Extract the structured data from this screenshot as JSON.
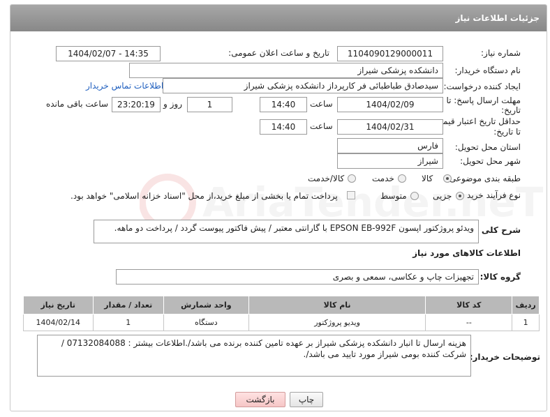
{
  "header": {
    "title": "جزئیات اطلاعات نیاز"
  },
  "form": {
    "need_number_label": "شماره نیاز:",
    "need_number": "1104090129000011",
    "announce_label": "تاریخ و ساعت اعلان عمومی:",
    "announce_value": "1404/02/07 - 14:35",
    "buyer_org_label": "نام دستگاه خریدار:",
    "buyer_org": "دانشکده پزشکی شیراز",
    "requester_label": "ایجاد کننده درخواست:",
    "requester": "سیدصادق طباطبائی فر کارپرداز دانشکده پزشکی شیراز",
    "contact_link": "اطلاعات تماس خریدار",
    "deadline_label_1": "مهلت ارسال پاسخ: تا",
    "deadline_label_2": "تاریخ:",
    "deadline_date": "1404/02/09",
    "time_label": "ساعت",
    "deadline_time": "14:40",
    "days_value": "1",
    "days_label": "روز و",
    "remaining_time": "23:20:19",
    "remaining_label": "ساعت باقی مانده",
    "min_validity_label_1": "حداقل تاریخ اعتبار قیمت:",
    "min_validity_label_2": "تا تاریخ:",
    "validity_date": "1404/02/31",
    "validity_time_label": "ساعت",
    "validity_time": "14:40",
    "province_label": "استان محل تحویل:",
    "province": "فارس",
    "city_label": "شهر محل تحویل:",
    "city": "شیراز",
    "category_label": "طبقه بندی موضوعی:",
    "category_options": [
      "کالا",
      "خدمت",
      "کالا/خدمت"
    ],
    "category_selected": "کالا",
    "process_label": "نوع فرآیند خرید :",
    "process_options": [
      "جزیی",
      "متوسط"
    ],
    "process_selected": "جزیی",
    "payment_note": "پرداخت تمام یا بخشی از مبلغ خرید،از محل \"اسناد خزانه اسلامی\" خواهد بود."
  },
  "description": {
    "label": "شرح کلی نیاز:",
    "text": "ویدئو پروژکتور اپسون EPSON EB-992F با گارانتی معتبر / پیش فاکتور پیوست گردد / پرداخت دو ماهه."
  },
  "goods": {
    "section_title": "اطلاعات کالاهای مورد نیاز",
    "group_label": "گروه کالا:",
    "group_value": "تجهیزات چاپ و عکاسی، سمعی و بصری",
    "columns": [
      "ردیف",
      "کد کالا",
      "نام کالا",
      "واحد شمارش",
      "تعداد / مقدار",
      "تاریخ نیاز"
    ],
    "rows": [
      {
        "row": "1",
        "code": "--",
        "name": "ویدیو پروژکتور",
        "unit": "دستگاه",
        "qty": "1",
        "date": "1404/02/14"
      }
    ]
  },
  "buyer_notes": {
    "label": "توضیحات خریدار:",
    "text": "هزینه ارسال تا انبار دانشکده پزشکی شیراز بر عهده تامین کننده برنده می باشد/.اطلاعات بیشتر : 07132084088 / شرکت کننده بومی شیراز مورد تایید می باشد/."
  },
  "buttons": {
    "print": "چاپ",
    "back": "بازگشت"
  },
  "watermark": {
    "text": "AriaTender.neT"
  },
  "colors": {
    "header_bg": "#999999",
    "link": "#1f5fbf",
    "back_button": "#f6c6c6"
  }
}
